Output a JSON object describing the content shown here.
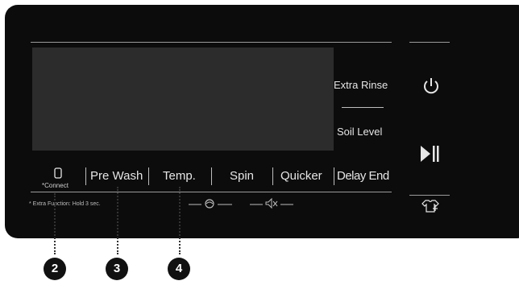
{
  "panel": {
    "side_options": {
      "extra_rinse": "Extra Rinse",
      "soil_level": "Soil Level"
    },
    "buttons": [
      {
        "id": "connect",
        "label": "*Connect",
        "icon": "phone-icon"
      },
      {
        "id": "pre-wash",
        "label": "Pre Wash"
      },
      {
        "id": "temp",
        "label": "Temp."
      },
      {
        "id": "spin",
        "label": "Spin"
      },
      {
        "id": "quicker",
        "label": "Quicker"
      },
      {
        "id": "delay-end",
        "label": "Delay End"
      }
    ],
    "extra_function_note": "* Extra Function: Hold 3 sec.",
    "sub_icons": [
      "drum-light-icon",
      "mute-icon"
    ],
    "right_column_icons": [
      "power-icon",
      "play-pause-icon",
      "shirt-plus-icon"
    ]
  },
  "callouts": [
    "2",
    "3",
    "4"
  ],
  "colors": {
    "panel": "#0c0c0c",
    "display": "#2c2c2c",
    "text": "#e6e6e6",
    "callout": "#111111"
  }
}
